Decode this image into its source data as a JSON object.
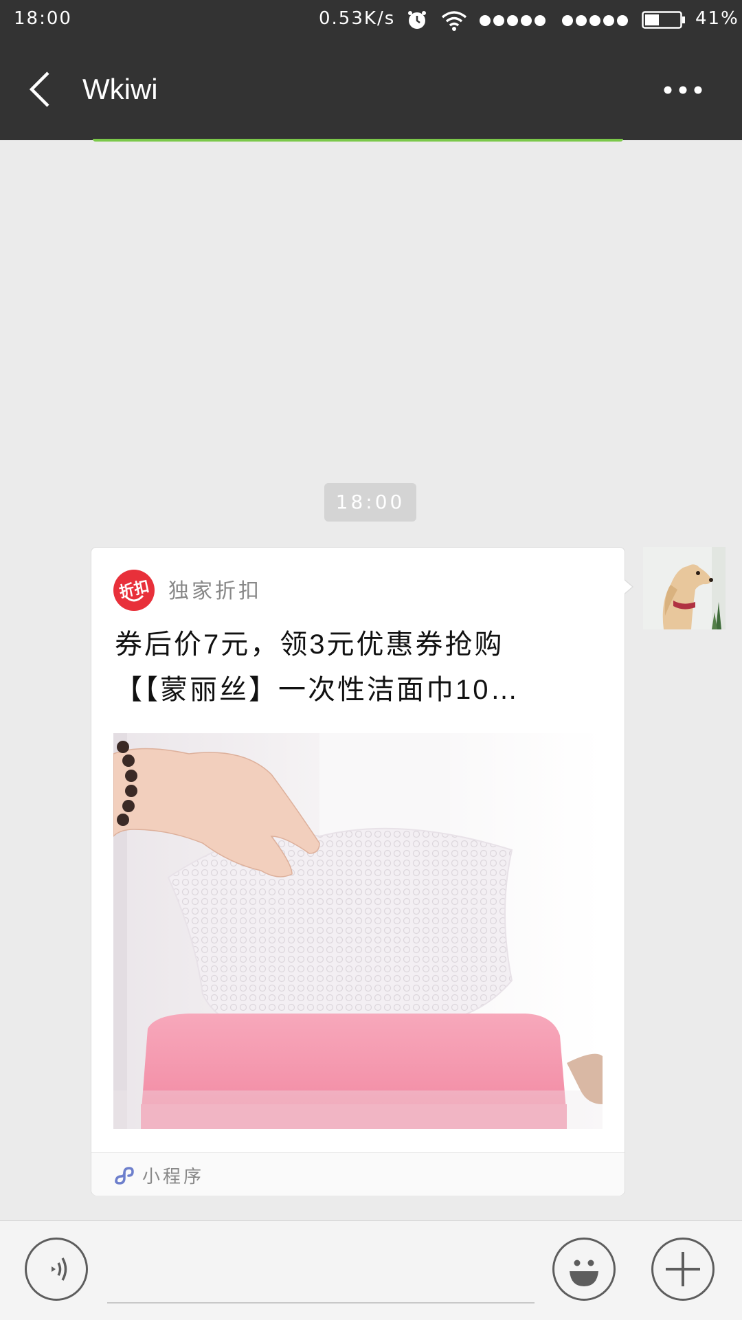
{
  "status_bar": {
    "time": "18:00",
    "network_speed": "0.53K/s",
    "battery_percent": "41%",
    "battery_level": 0.41,
    "icons": [
      "alarm-icon",
      "wifi-icon",
      "signal-icon",
      "signal-icon",
      "battery-icon"
    ]
  },
  "nav": {
    "title": "Wkiwi",
    "back_icon": "chevron-left-icon",
    "more_icon": "more-dots-icon"
  },
  "chat": {
    "timestamp": "18:00",
    "message": {
      "source_logo_text": "折扣",
      "source_name": "独家折扣",
      "title_line1": "券后价7元，领3元优惠券抢购",
      "title_line2": "【【蒙丽丝】一次性洁面巾10…",
      "footer_label": "小程序",
      "footer_icon": "mini-program-icon"
    }
  },
  "input_bar": {
    "voice_icon": "voice-icon",
    "emoji_icon": "emoji-icon",
    "plus_icon": "plus-icon"
  },
  "colors": {
    "bar": "#333333",
    "background": "#ebebeb",
    "accent_green": "#7bc84a",
    "logo_red": "#e8303a",
    "mini_program_blue": "#6d7fcc"
  }
}
